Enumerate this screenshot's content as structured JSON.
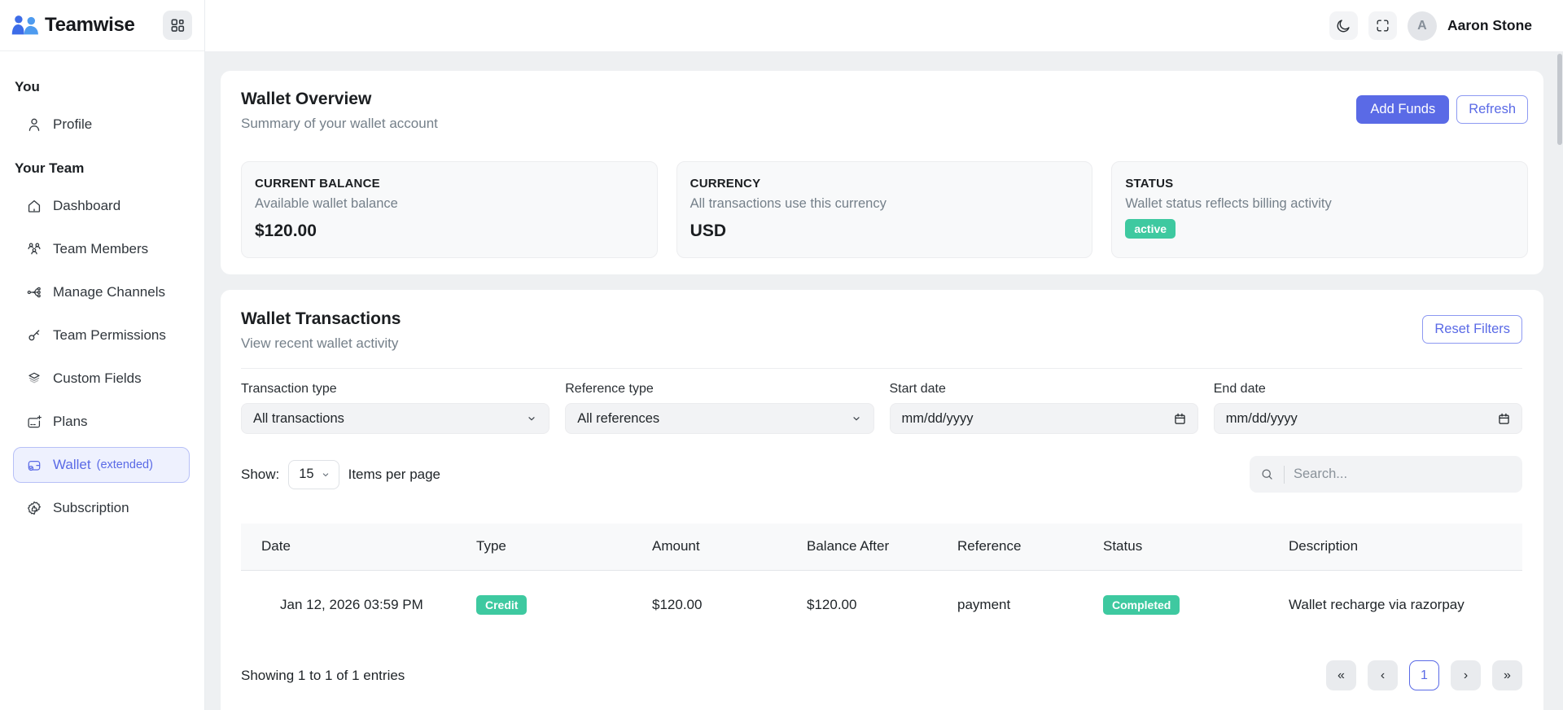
{
  "brand": {
    "name": "Teamwise"
  },
  "header": {
    "user_initial": "A",
    "user_name": "Aaron Stone"
  },
  "sidebar": {
    "sections": [
      {
        "label": "You",
        "items": [
          {
            "label": "Profile",
            "icon": "user-icon",
            "active": false
          }
        ]
      },
      {
        "label": "Your Team",
        "items": [
          {
            "label": "Dashboard",
            "icon": "home-icon",
            "active": false
          },
          {
            "label": "Team Members",
            "icon": "users-icon",
            "active": false
          },
          {
            "label": "Manage Channels",
            "icon": "channels-icon",
            "active": false
          },
          {
            "label": "Team Permissions",
            "icon": "key-icon",
            "active": false
          },
          {
            "label": "Custom Fields",
            "icon": "layers-icon",
            "active": false
          },
          {
            "label": "Plans",
            "icon": "card-plus-icon",
            "active": false
          },
          {
            "label": "Wallet",
            "suffix": "(extended)",
            "icon": "wallet-icon",
            "active": true
          },
          {
            "label": "Subscription",
            "icon": "rosette-icon",
            "active": false
          }
        ]
      }
    ]
  },
  "overview": {
    "title": "Wallet Overview",
    "subtitle": "Summary of your wallet account",
    "add_funds_label": "Add Funds",
    "refresh_label": "Refresh",
    "cards": [
      {
        "title": "CURRENT BALANCE",
        "subtitle": "Available wallet balance",
        "value": "$120.00"
      },
      {
        "title": "CURRENCY",
        "subtitle": "All transactions use this currency",
        "value": "USD"
      },
      {
        "title": "STATUS",
        "subtitle": "Wallet status reflects billing activity",
        "badge": "active"
      }
    ]
  },
  "transactions": {
    "title": "Wallet Transactions",
    "subtitle": "View recent wallet activity",
    "reset_label": "Reset Filters",
    "filters": [
      {
        "label": "Transaction type",
        "value": "All transactions",
        "type": "select"
      },
      {
        "label": "Reference type",
        "value": "All references",
        "type": "select"
      },
      {
        "label": "Start date",
        "value": "mm/dd/yyyy",
        "type": "date"
      },
      {
        "label": "End date",
        "value": "mm/dd/yyyy",
        "type": "date"
      }
    ],
    "show_label": "Show:",
    "page_size": "15",
    "items_per_page_label": "Items per page",
    "search_placeholder": "Search...",
    "table": {
      "columns": [
        "Date",
        "Type",
        "Amount",
        "Balance After",
        "Reference",
        "Status",
        "Description"
      ],
      "rows": [
        {
          "date": "Jan 12, 2026 03:59 PM",
          "type": "Credit",
          "amount": "$120.00",
          "balance_after": "$120.00",
          "reference": "payment",
          "status": "Completed",
          "description": "Wallet recharge via razorpay"
        }
      ]
    },
    "footer": {
      "summary": "Showing 1 to 1 of 1 entries",
      "pagination": [
        "«",
        "‹",
        "1",
        "›",
        "»"
      ],
      "active_page": "1"
    }
  },
  "colors": {
    "accent": "#5a6ae6",
    "success": "#3ec9a0",
    "active_item_bg": "#eef1fe"
  }
}
